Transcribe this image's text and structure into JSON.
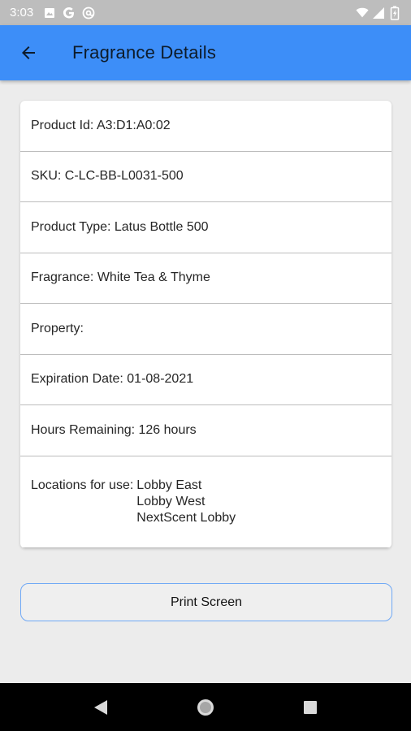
{
  "status_bar": {
    "time": "3:03",
    "left_icons": [
      "image-icon",
      "google-g-icon",
      "at-sign-icon"
    ],
    "right_icons": [
      "wifi-icon",
      "signal-icon",
      "battery-icon"
    ]
  },
  "app_bar": {
    "title": "Fragrance Details",
    "back_icon": "arrow-left-icon",
    "background": "#3d8ef8"
  },
  "details": {
    "product_id": "Product Id: A3:D1:A0:02",
    "sku": "SKU: C-LC-BB-L0031-500",
    "product_type": "Product Type: Latus Bottle 500",
    "fragrance": "Fragrance: White Tea & Thyme",
    "property": "Property:",
    "expiration_date": "Expiration Date: 01-08-2021",
    "hours_remaining": "Hours Remaining: 126 hours",
    "locations_label": "Locations for use:",
    "locations": [
      "Lobby East",
      "Lobby West",
      "NextScent Lobby"
    ]
  },
  "print_button": {
    "label": "Print Screen",
    "border_color": "#6fa8f5"
  },
  "nav_bar": {
    "buttons": [
      "back-triangle-icon",
      "home-circle-icon",
      "recents-square-icon"
    ]
  }
}
